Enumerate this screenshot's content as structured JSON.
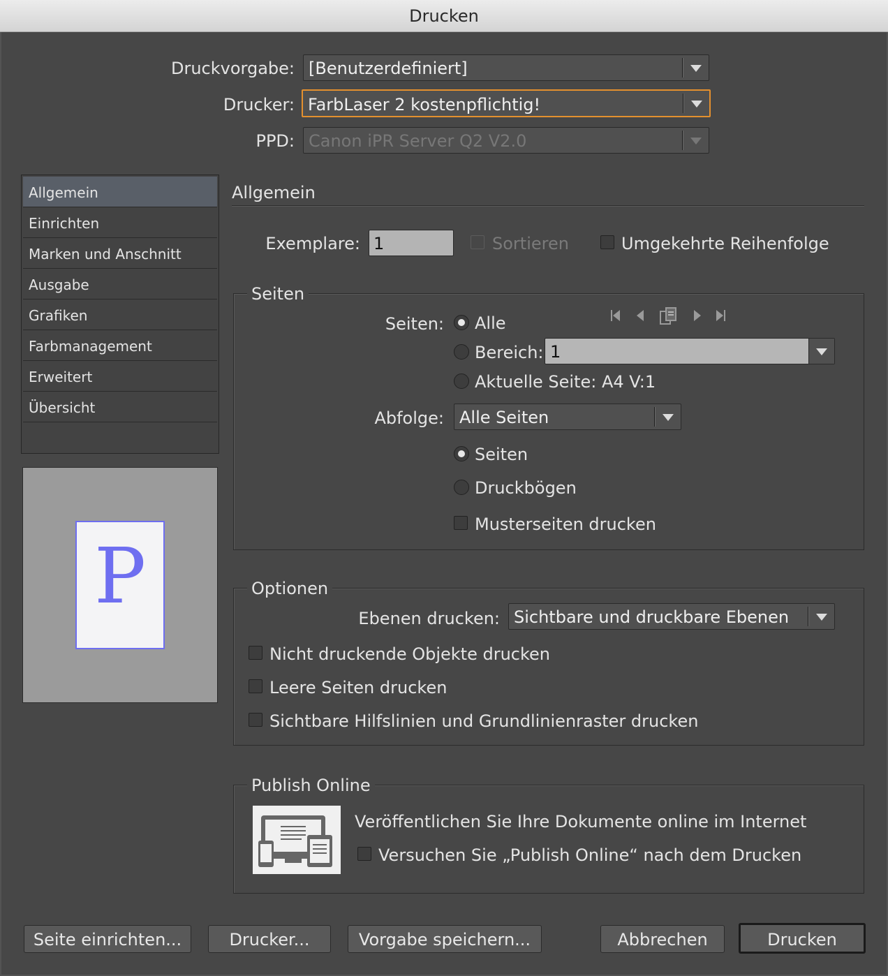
{
  "window": {
    "title": "Drucken"
  },
  "top": {
    "preset_label": "Druckvorgabe:",
    "preset_value": "[Benutzerdefiniert]",
    "printer_label": "Drucker:",
    "printer_value": "FarbLaser 2 kostenpflichtig!",
    "ppd_label": "PPD:",
    "ppd_value": "Canon iPR Server Q2 V2.0"
  },
  "sidebar": {
    "items": [
      {
        "label": "Allgemein"
      },
      {
        "label": "Einrichten"
      },
      {
        "label": "Marken und Anschnitt"
      },
      {
        "label": "Ausgabe"
      },
      {
        "label": "Grafiken"
      },
      {
        "label": "Farbmanagement"
      },
      {
        "label": "Erweitert"
      },
      {
        "label": "Übersicht"
      }
    ],
    "preview_letter": "P"
  },
  "main": {
    "section_title": "Allgemein",
    "copies_label": "Exemplare:",
    "copies_value": "1",
    "collate_label": "Sortieren",
    "reverse_label": "Umgekehrte Reihenfolge",
    "pages_group": {
      "legend": "Seiten",
      "pages_label": "Seiten:",
      "all_label": "Alle",
      "range_label": "Bereich:",
      "range_value": "1",
      "current_label": "Aktuelle Seite: A4 V:1",
      "sequence_label": "Abfolge:",
      "sequence_value": "Alle Seiten",
      "pages_radio_label": "Seiten",
      "spreads_label": "Druckbögen",
      "master_label": "Musterseiten drucken",
      "nav_icons": [
        "first-page-icon",
        "previous-page-icon",
        "page-copy-icon",
        "next-page-icon",
        "last-page-icon"
      ]
    },
    "options_group": {
      "legend": "Optionen",
      "layers_label": "Ebenen drucken:",
      "layers_value": "Sichtbare und druckbare Ebenen",
      "nonprinting_label": "Nicht druckende Objekte drucken",
      "blank_label": "Leere Seiten drucken",
      "guides_label": "Sichtbare Hilfslinien und Grundlinienraster drucken"
    },
    "publish_group": {
      "legend": "Publish Online",
      "description": "Veröffentlichen Sie Ihre Dokumente online im Internet",
      "try_label": "Versuchen Sie „Publish Online“ nach dem Drucken",
      "icon": "devices-icon"
    }
  },
  "buttons": {
    "page_setup": "Seite einrichten...",
    "printer": "Drucker...",
    "save_preset": "Vorgabe speichern...",
    "cancel": "Abbrechen",
    "print": "Drucken"
  },
  "colors": {
    "focus": "#e4902e",
    "preview_accent": "#6e6ef0",
    "selected_nav": "#595f68"
  }
}
